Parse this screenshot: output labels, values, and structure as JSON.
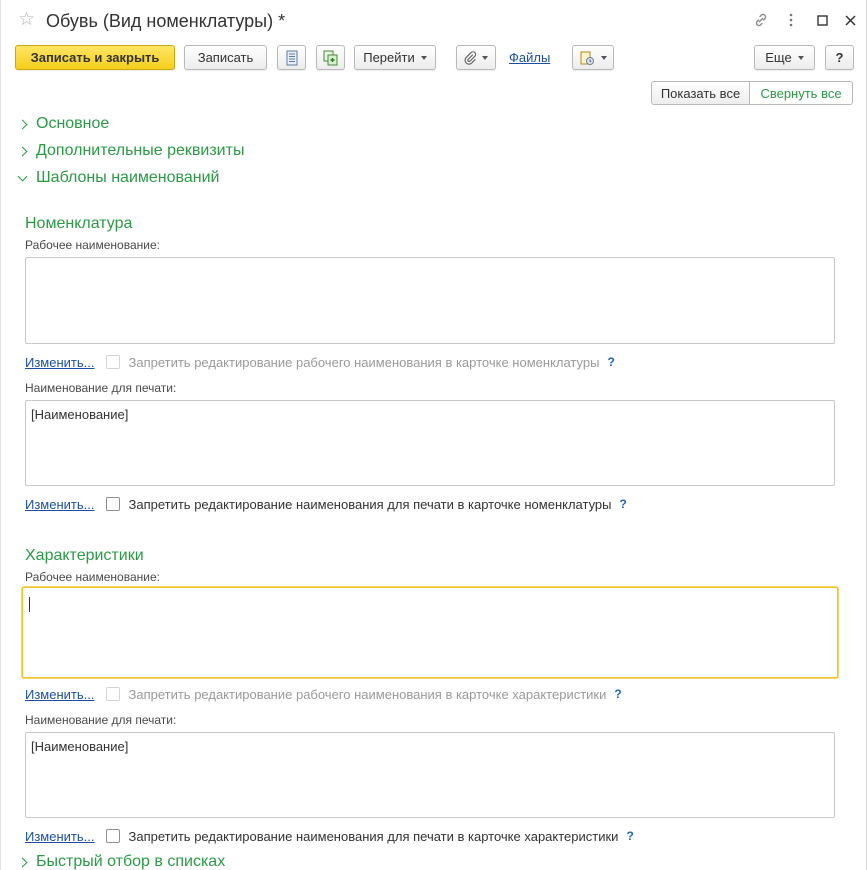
{
  "window": {
    "title": "Обувь (Вид номенклатуры) *",
    "star_icon": "star-icon",
    "link_icon": "link-icon",
    "menu_icon": "more-vert-icon",
    "maximize_icon": "maximize-icon",
    "close_icon": "close-icon"
  },
  "toolbar": {
    "save_close_label": "Записать и закрыть",
    "save_label": "Записать",
    "goto_label": "Перейти",
    "files_label": "Файлы",
    "more_label": "Еще",
    "help_label": "?"
  },
  "view_toggle": {
    "show_all_label": "Показать все",
    "collapse_all_label": "Свернуть все"
  },
  "groups": {
    "main_label": "Основное",
    "extra_label": "Дополнительные реквизиты",
    "templates_label": "Шаблоны наименований",
    "quick_filter_label": "Быстрый отбор в списках"
  },
  "nomenclature": {
    "title": "Номенклатура",
    "work_name_label": "Рабочее наименование:",
    "work_name_value": "",
    "change_link_1": "Изменить...",
    "forbid_work_label": "Запретить редактирование рабочего наименования в карточке номенклатуры",
    "print_name_label": "Наименование для печати:",
    "print_name_value": "[Наименование]",
    "change_link_2": "Изменить...",
    "forbid_print_label": "Запретить редактирование наименования для печати в карточке номенклатуры"
  },
  "characteristics": {
    "title": "Характеристики",
    "work_name_label": "Рабочее наименование:",
    "work_name_value": "",
    "change_link_1": "Изменить...",
    "forbid_work_label": "Запретить редактирование рабочего наименования в карточке характеристики",
    "print_name_label": "Наименование для печати:",
    "print_name_value": "[Наименование]",
    "change_link_2": "Изменить...",
    "forbid_print_label": "Запретить редактирование наименования для печати в карточке характеристики"
  },
  "help_mark": "?",
  "colors": {
    "accent_green": "#2b9a45",
    "primary_yellow": "#f5cf1b",
    "link_blue": "#1c4fa4",
    "focus_border": "#f2c027"
  }
}
